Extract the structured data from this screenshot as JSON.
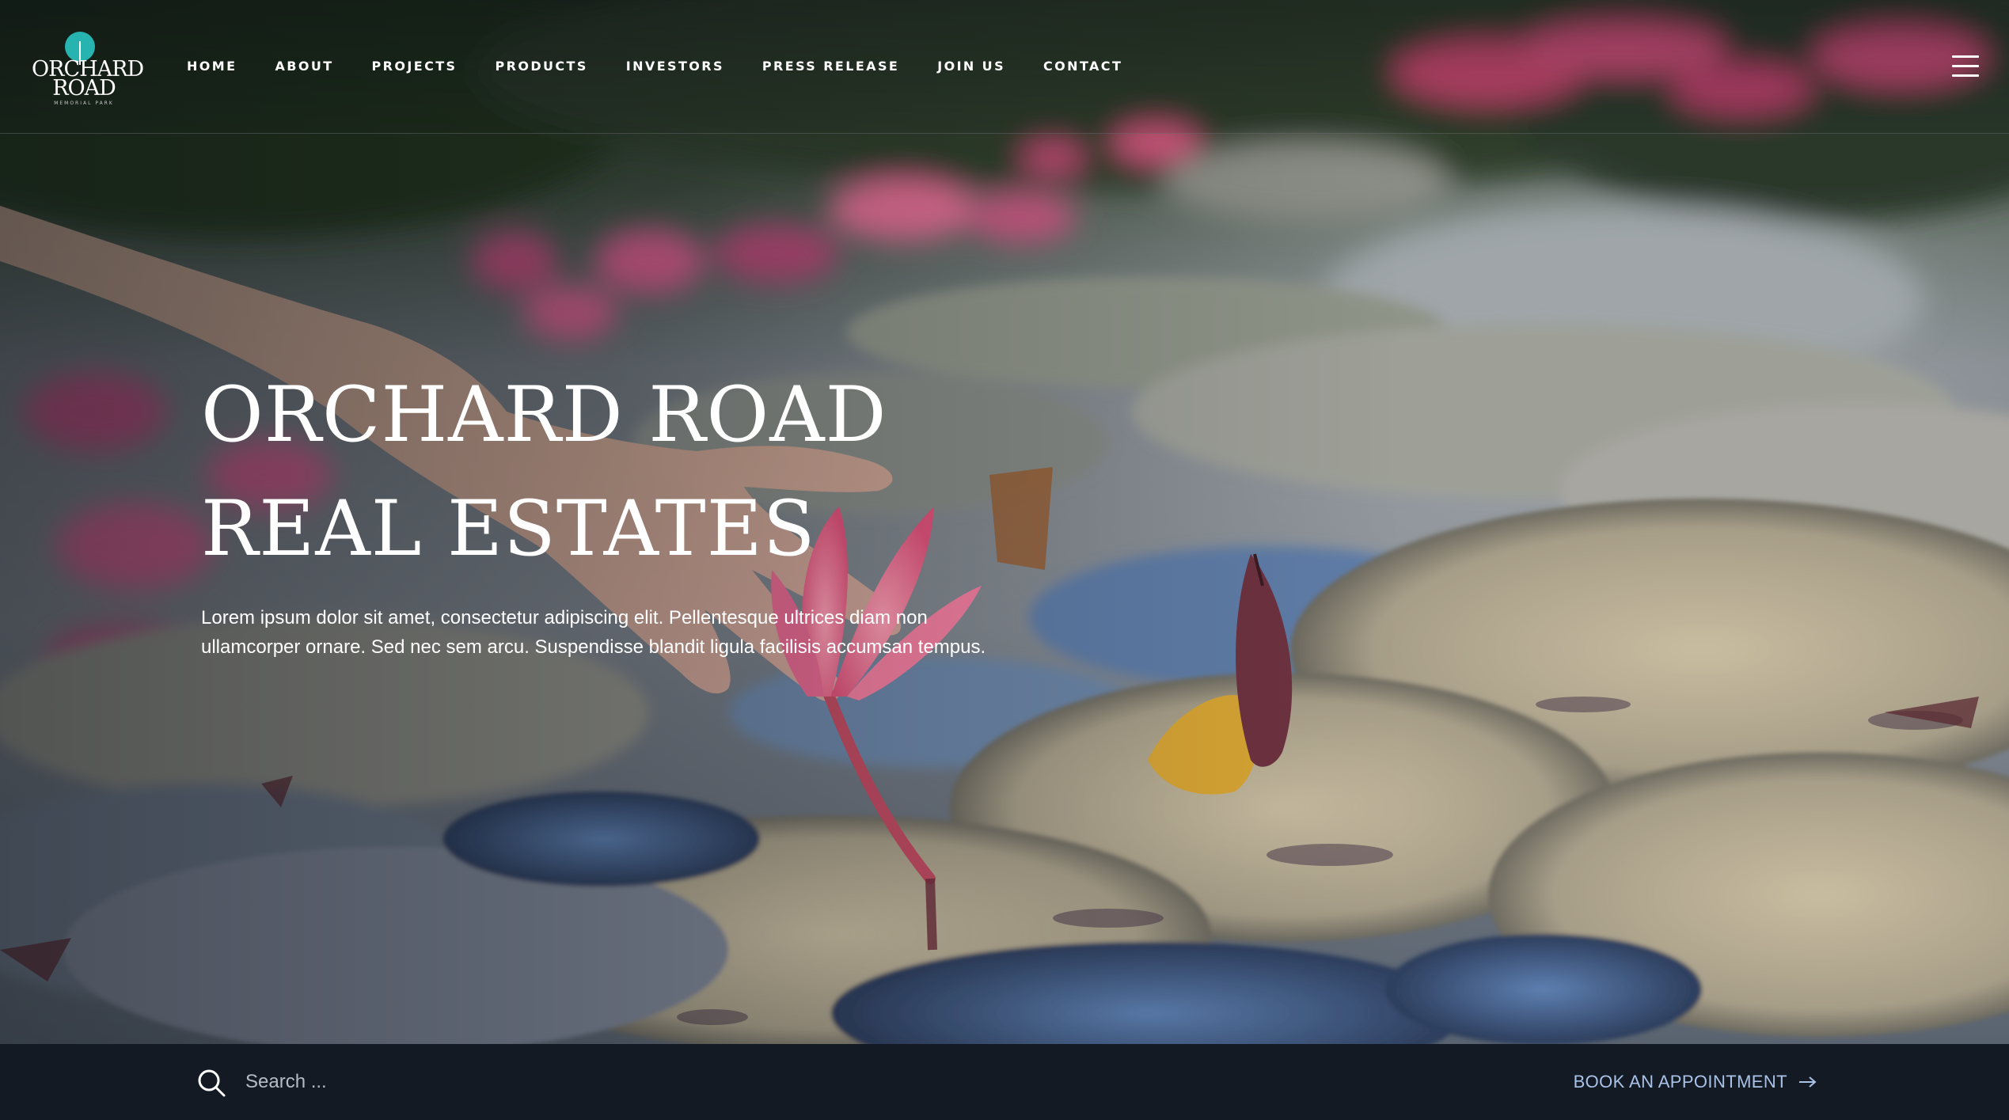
{
  "brand": {
    "logo_line1": "ORCHARD",
    "logo_line2": "ROAD",
    "logo_tagline": "MEMORIAL PARK",
    "accent": "#27b3b0"
  },
  "nav": {
    "items": [
      {
        "label": "HOME"
      },
      {
        "label": "ABOUT"
      },
      {
        "label": "PROJECTS"
      },
      {
        "label": "PRODUCTS"
      },
      {
        "label": "INVESTORS"
      },
      {
        "label": "PRESS RELEASE"
      },
      {
        "label": "JOIN US"
      },
      {
        "label": "CONTACT"
      }
    ],
    "menu_icon": "hamburger-icon"
  },
  "hero": {
    "title_line1": "ORCHARD ROAD",
    "title_line2": "REAL ESTATES",
    "description": "Lorem ipsum dolor sit amet, consectetur adipiscing elit. Pellentesque ultrices diam non ullamcorper ornare. Sed nec sem arcu. Suspendisse blandit ligula facilisis accumsan tempus.",
    "background_image": "hand-touching-lotus-on-pond"
  },
  "bottom_bar": {
    "search_icon": "search-icon",
    "search_placeholder": "Search ...",
    "book_label": "BOOK AN APPOINTMENT",
    "book_icon": "arrow-right-icon",
    "background": "#141a24",
    "link_color": "#a9c2e8"
  }
}
